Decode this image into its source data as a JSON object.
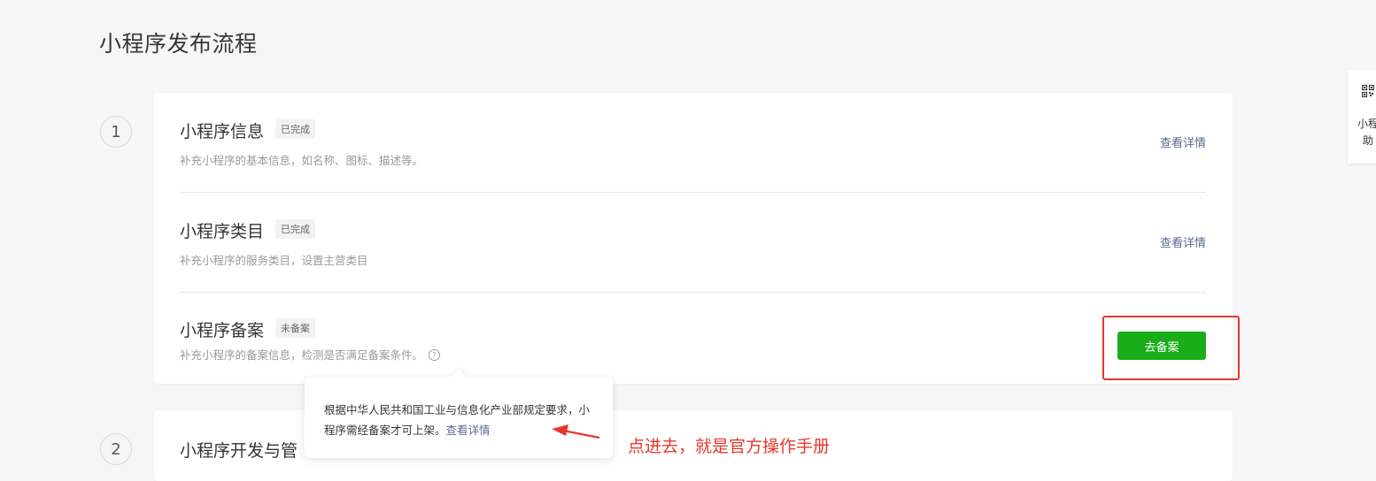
{
  "page": {
    "title": "小程序发布流程"
  },
  "steps": [
    {
      "number": "1",
      "items": [
        {
          "title": "小程序信息",
          "badge": "已完成",
          "desc": "补充小程序的基本信息，如名称、图标、描述等。",
          "action": "查看详情"
        },
        {
          "title": "小程序类目",
          "badge": "已完成",
          "desc": "补充小程序的服务类目，设置主营类目",
          "action": "查看详情"
        },
        {
          "title": "小程序备案",
          "badge": "未备案",
          "desc": "补充小程序的备案信息，检测是否满足备案条件。",
          "action": "去备案"
        }
      ]
    },
    {
      "number": "2",
      "title": "小程序开发与管"
    }
  ],
  "tooltip": {
    "text": "根据中华人民共和国工业与信息化产业部规定要求，小程序需经备案才可上架。",
    "link": "查看详情"
  },
  "annotation": {
    "text": "点进去，就是官方操作手册",
    "color": "#e8372c"
  },
  "right_widget": {
    "icon": "qr-code-icon",
    "line1": "小程",
    "line2": "助"
  },
  "colors": {
    "primary_button": "#1aad19",
    "link": "#576b95",
    "highlight": "#e8372c"
  }
}
